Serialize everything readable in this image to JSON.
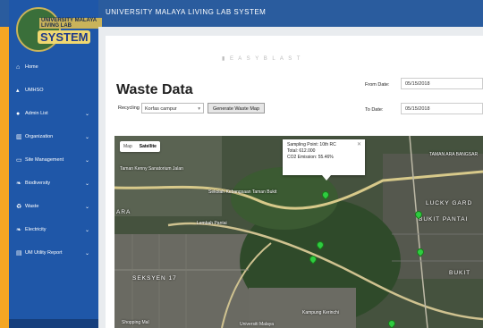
{
  "header": {
    "app_title": "UNIVERSITY MALAYA LIVING LAB SYSTEM"
  },
  "logo": {
    "line1": "UNIVERSITY MALAYA LIVING LAB",
    "line2": "SYSTEM"
  },
  "sidebar": {
    "items": [
      {
        "label": "Home",
        "icon": "home-icon",
        "chevron": false
      },
      {
        "label": "UMHSO",
        "icon": "flame-icon",
        "chevron": false
      },
      {
        "label": "Admin List",
        "icon": "user-icon",
        "chevron": true
      },
      {
        "label": "Organization",
        "icon": "building-icon",
        "chevron": true
      },
      {
        "label": "Site Management",
        "icon": "monitor-icon",
        "chevron": true
      },
      {
        "label": "Biodiversity",
        "icon": "leaf-icon",
        "chevron": true
      },
      {
        "label": "Waste",
        "icon": "recycle-icon",
        "chevron": true
      },
      {
        "label": "Electricity",
        "icon": "leaf-icon",
        "chevron": true
      },
      {
        "label": "UM Utility Report",
        "icon": "chart-icon",
        "chevron": true
      }
    ]
  },
  "main": {
    "watermark": "▮ E A S Y B L A S T",
    "title": "Waste Data",
    "filter_label": "Recycling",
    "select_value": "Korfas campur",
    "generate_button": "Generate Waste Map",
    "from_label": "From Date:",
    "from_value": "05/15/2018",
    "to_label": "To Date:",
    "to_value": "05/15/2018"
  },
  "map": {
    "type_map": "Map",
    "type_satellite": "Satellite",
    "info": {
      "title": "Sampling Point: 10th RC",
      "total": "Total: 612.000",
      "co2": "CO2 Emission: 55.46%"
    },
    "labels": {
      "a": "Taman Kenny Sanatorium Jalan",
      "b": "SEKSYEN 17",
      "c": "LUCKY GARD",
      "d": "BUKIT PANTAI",
      "e": "TAMAN ARA BANGSAR",
      "f": "BUKIT",
      "g": "Shopping Mal",
      "h": "Universiti Malaya",
      "i": "Kampung Kerinchi",
      "j": "Sekolah Kebangsaan Taman Bukit",
      "k": "ARA",
      "l": "Lembah Pantai"
    }
  }
}
